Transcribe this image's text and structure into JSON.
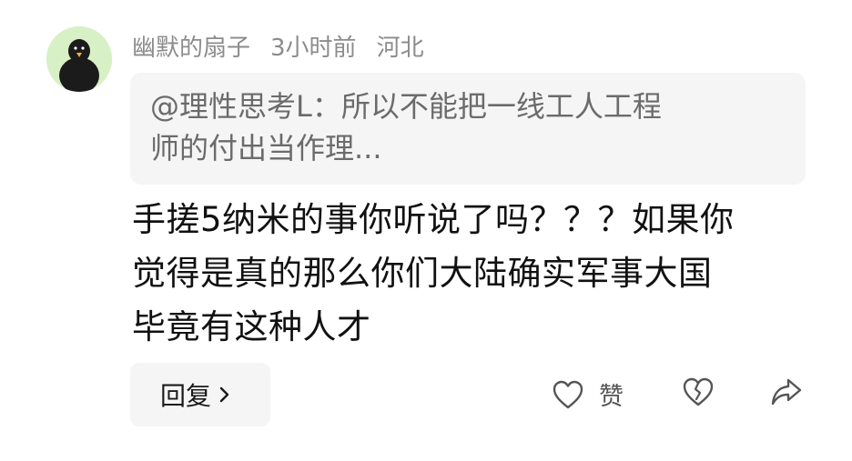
{
  "comment": {
    "avatar_icon": "penguin-icon",
    "avatar_bg": "#d8f0c5",
    "username": "幽默的扇子",
    "time": "3小时前",
    "location": "河北",
    "quote": {
      "lines": [
        "@理性思考L：所以不能把一线工人工程",
        "师的付出当作理..."
      ]
    },
    "content": {
      "lines": [
        "手搓5纳米的事你听说了吗？？？如果你",
        "觉得是真的那么你们大陆确实军事大国",
        "毕竟有这种人才"
      ]
    },
    "reply_label": "回复",
    "like_label": "赞",
    "like_icon": "heart-outline-icon",
    "dislike_icon": "broken-heart-icon",
    "share_icon": "share-arrow-icon"
  }
}
